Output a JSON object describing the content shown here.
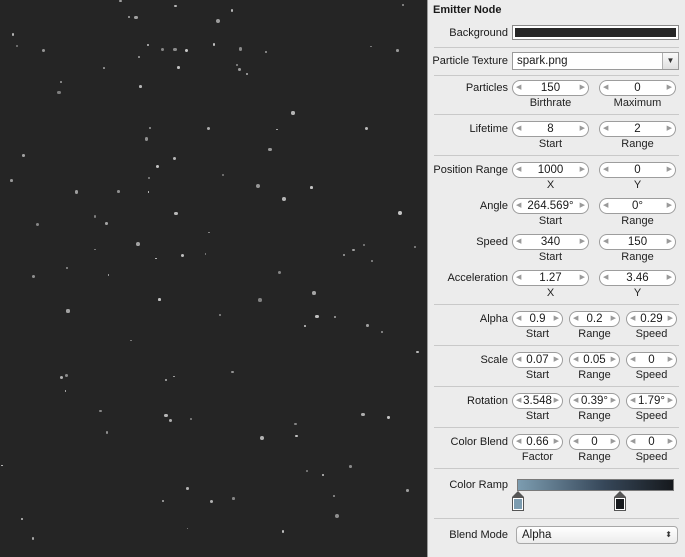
{
  "panel": {
    "title": "Emitter Node",
    "background": {
      "label": "Background",
      "color": "#262626"
    },
    "texture": {
      "label": "Particle Texture",
      "value": "spark.png",
      "dropdown_icon": "triangle-down-icon"
    },
    "particles": {
      "label": "Particles",
      "birthrate": "150",
      "birthrate_sub": "Birthrate",
      "maximum": "0",
      "maximum_sub": "Maximum"
    },
    "lifetime": {
      "label": "Lifetime",
      "start": "8",
      "start_sub": "Start",
      "range": "2",
      "range_sub": "Range"
    },
    "position_range": {
      "label": "Position Range",
      "x": "1000",
      "x_sub": "X",
      "y": "0",
      "y_sub": "Y"
    },
    "angle": {
      "label": "Angle",
      "start": "264.569°",
      "start_sub": "Start",
      "range": "0°",
      "range_sub": "Range"
    },
    "speed": {
      "label": "Speed",
      "start": "340",
      "start_sub": "Start",
      "range": "150",
      "range_sub": "Range"
    },
    "acceleration": {
      "label": "Acceleration",
      "x": "1.27",
      "x_sub": "X",
      "y": "3.46",
      "y_sub": "Y"
    },
    "alpha": {
      "label": "Alpha",
      "start": "0.9",
      "start_sub": "Start",
      "range": "0.2",
      "range_sub": "Range",
      "speed": "0.29",
      "speed_sub": "Speed"
    },
    "scale": {
      "label": "Scale",
      "start": "0.07",
      "start_sub": "Start",
      "range": "0.05",
      "range_sub": "Range",
      "speed": "0",
      "speed_sub": "Speed"
    },
    "rotation": {
      "label": "Rotation",
      "start": "3.548",
      "start_sub": "Start",
      "range": "0.39°",
      "range_sub": "Range",
      "speed": "1.79°",
      "speed_sub": "Speed"
    },
    "color_blend": {
      "label": "Color Blend",
      "factor": "0.66",
      "factor_sub": "Factor",
      "range": "0",
      "range_sub": "Range",
      "speed": "0",
      "speed_sub": "Speed"
    },
    "color_ramp": {
      "label": "Color Ramp",
      "stop_colors": [
        "#7c9cb0",
        "#16191d"
      ]
    },
    "blend_mode": {
      "label": "Blend Mode",
      "value": "Alpha",
      "icon": "updown-arrows-icon"
    }
  },
  "colors": {
    "canvas_background": "#252525",
    "particle": "#c8c8c8",
    "panel_background": "#ececec"
  }
}
